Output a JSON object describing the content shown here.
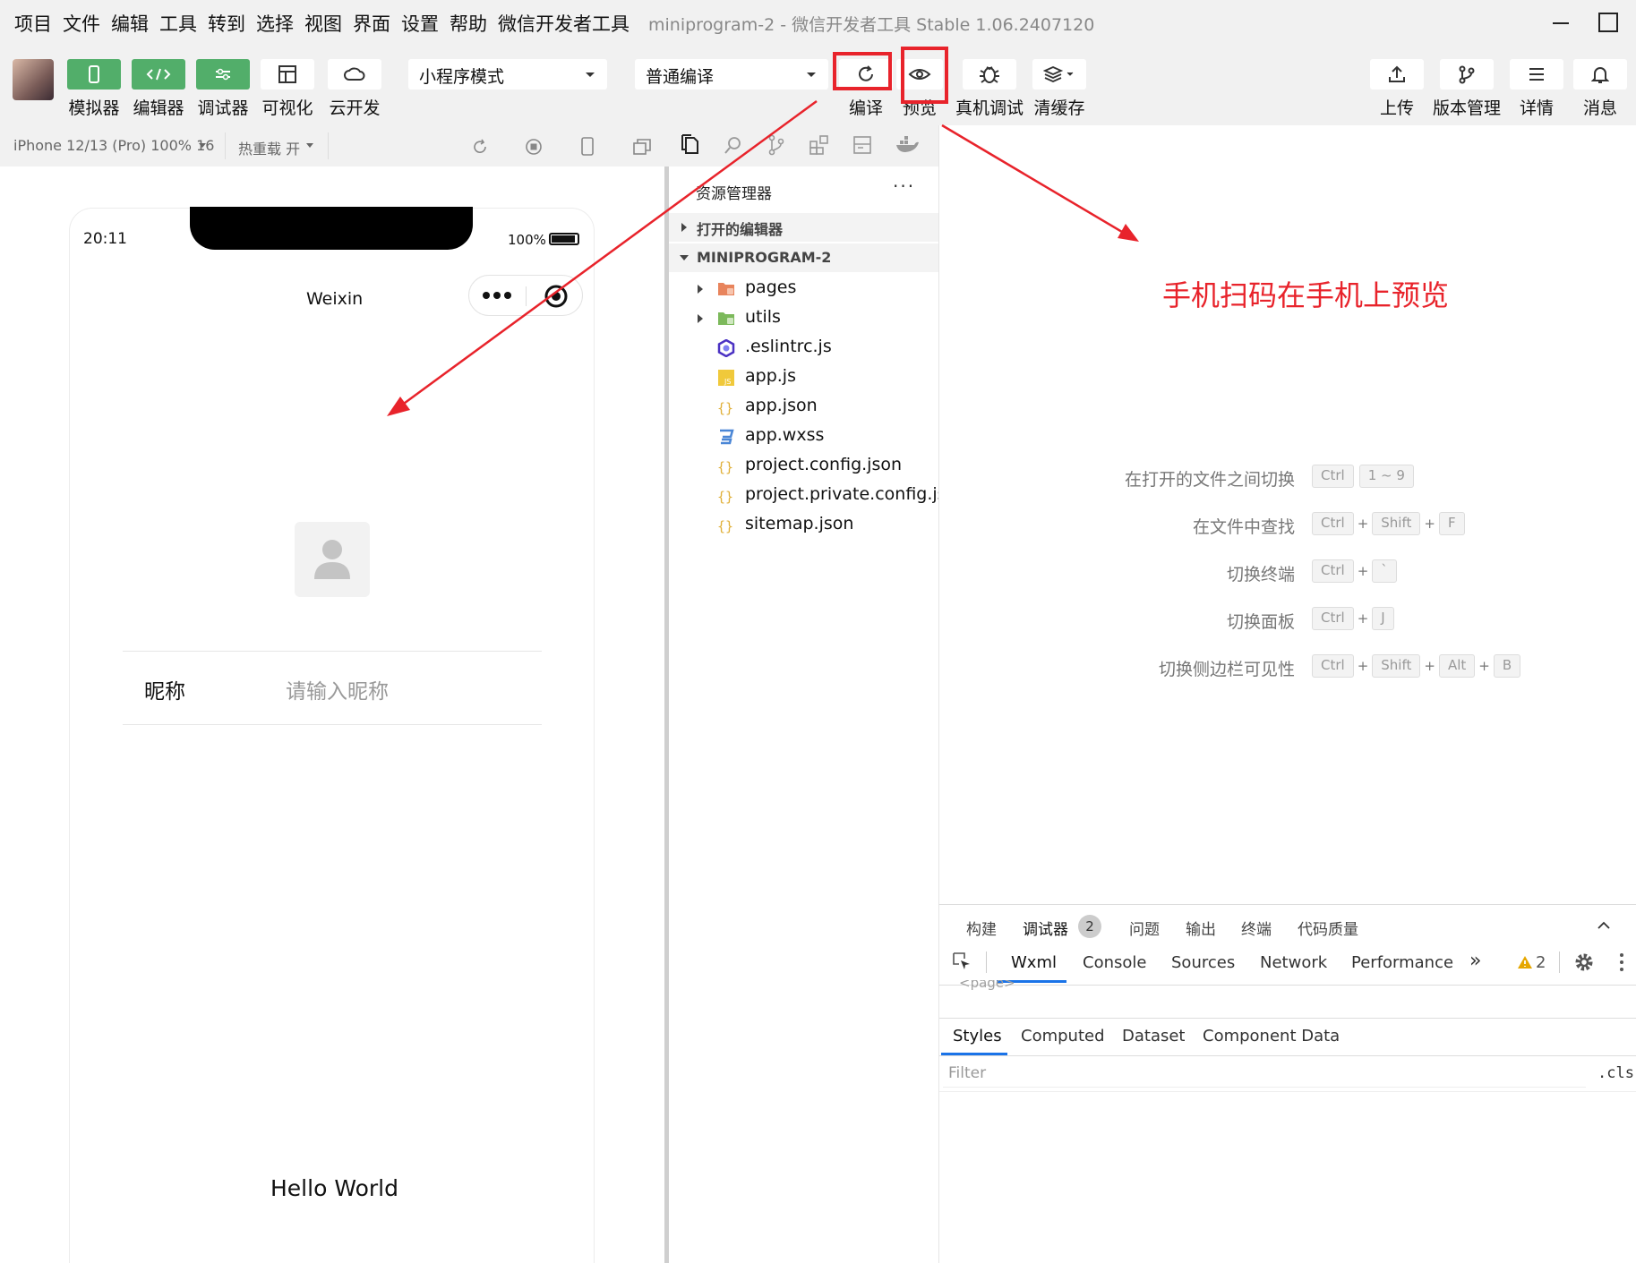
{
  "menubar": {
    "items": [
      "项目",
      "文件",
      "编辑",
      "工具",
      "转到",
      "选择",
      "视图",
      "界面",
      "设置",
      "帮助",
      "微信开发者工具"
    ],
    "title": "miniprogram-2 - 微信开发者工具 Stable 1.06.2407120"
  },
  "toolbar": {
    "simulator_label": "模拟器",
    "editor_label": "编辑器",
    "debugger_label": "调试器",
    "visual_label": "可视化",
    "cloud_label": "云开发",
    "mode_select": "小程序模式",
    "compile_select": "普通编译",
    "compile_label": "编译",
    "preview_label": "预览",
    "remote_debug_label": "真机调试",
    "clear_cache_label": "清缓存",
    "upload_label": "上传",
    "version_label": "版本管理",
    "details_label": "详情",
    "messages_label": "消息"
  },
  "simbar": {
    "device": "iPhone 12/13 (Pro) 100% 16",
    "hot_reload": "热重载 开"
  },
  "phone": {
    "time": "20:11",
    "battery": "100%",
    "nav_title": "Weixin",
    "nickname_label": "昵称",
    "nickname_placeholder": "请输入昵称",
    "hello": "Hello World"
  },
  "explorer": {
    "title": "资源管理器",
    "more": "···",
    "open_editors": "打开的编辑器",
    "project": "MINIPROGRAM-2",
    "files": [
      {
        "name": "pages",
        "icon": "folder-pages-icon"
      },
      {
        "name": "utils",
        "icon": "folder-utils-icon"
      },
      {
        "name": ".eslintrc.js",
        "icon": "eslint-icon"
      },
      {
        "name": "app.js",
        "icon": "js-file-icon"
      },
      {
        "name": "app.json",
        "icon": "json-file-icon"
      },
      {
        "name": "app.wxss",
        "icon": "css-file-icon"
      },
      {
        "name": "project.config.json",
        "icon": "json-file-icon"
      },
      {
        "name": "project.private.config.js...",
        "icon": "json-file-icon"
      },
      {
        "name": "sitemap.json",
        "icon": "json-file-icon"
      }
    ]
  },
  "annotation": {
    "text": "手机扫码在手机上预览",
    "color": "#e8232b"
  },
  "shortcuts": [
    {
      "label": "在打开的文件之间切换",
      "keys": [
        "Ctrl",
        "1 ~ 9"
      ],
      "sep": " "
    },
    {
      "label": "在文件中查找",
      "keys": [
        "Ctrl",
        "Shift",
        "F"
      ],
      "sep": "+"
    },
    {
      "label": "切换终端",
      "keys": [
        "Ctrl",
        "`"
      ],
      "sep": "+"
    },
    {
      "label": "切换面板",
      "keys": [
        "Ctrl",
        "J"
      ],
      "sep": "+"
    },
    {
      "label": "切换侧边栏可见性",
      "keys": [
        "Ctrl",
        "Shift",
        "Alt",
        "B"
      ],
      "sep": "+"
    }
  ],
  "debugger": {
    "tabs": [
      "构建",
      "调试器",
      "问题",
      "输出",
      "终端",
      "代码质量"
    ],
    "debugger_badge": "2",
    "devtools_tabs": [
      "Wxml",
      "Console",
      "Sources",
      "Network",
      "Performance"
    ],
    "more_tabs": "»",
    "warning_count": "2",
    "wxml_node": "<page>",
    "style_tabs": [
      "Styles",
      "Computed",
      "Dataset",
      "Component Data"
    ],
    "filter_placeholder": "Filter",
    "cls": ".cls"
  },
  "colors": {
    "green": "#52ae6a",
    "red": "#e8232b",
    "accent_blue": "#1a73e8"
  }
}
